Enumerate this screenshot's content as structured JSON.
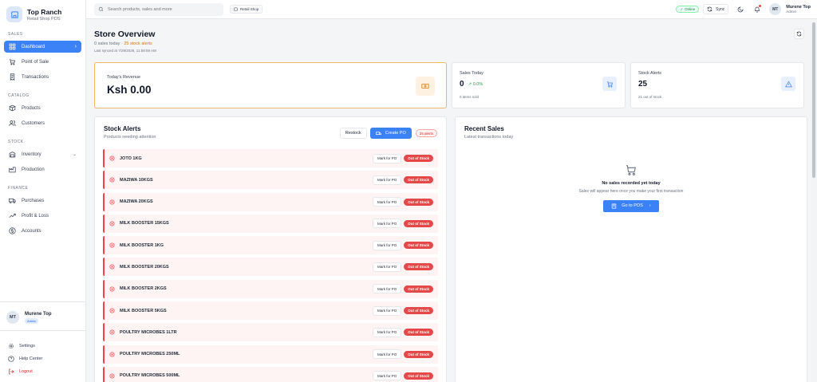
{
  "brand": {
    "name": "Top Ranch",
    "subtitle": "Retail Shop POS"
  },
  "sidebar": {
    "sections": [
      {
        "label": "SALES"
      },
      {
        "label": "CATALOG"
      },
      {
        "label": "STOCK"
      },
      {
        "label": "FINANCE"
      }
    ],
    "items": [
      {
        "label": "Dashboard",
        "icon": "dashboard-icon"
      },
      {
        "label": "Point of Sale",
        "icon": "cart-icon"
      },
      {
        "label": "Transactions",
        "icon": "receipt-icon"
      },
      {
        "label": "Products",
        "icon": "box-icon"
      },
      {
        "label": "Customers",
        "icon": "users-icon"
      },
      {
        "label": "Inventory",
        "icon": "warehouse-icon"
      },
      {
        "label": "Production",
        "icon": "factory-icon"
      },
      {
        "label": "Purchases",
        "icon": "truck-icon"
      },
      {
        "label": "Profit & Loss",
        "icon": "trend-icon"
      },
      {
        "label": "Accounts",
        "icon": "dollar-icon"
      }
    ],
    "user": {
      "initials": "MT",
      "name": "Murene Top",
      "role": "Admin"
    },
    "footer": {
      "settings": "Settings",
      "help": "Help Center",
      "logout": "Logout"
    }
  },
  "topbar": {
    "search_placeholder": "Search products, sales and more",
    "shop": "Retail Shop",
    "online": "Online",
    "sync": "Sync",
    "user": {
      "initials": "MT",
      "name": "Murene Top",
      "role": "Admin"
    }
  },
  "page": {
    "title": "Store Overview",
    "sub_sales": "0 sales today",
    "sub_sep": " · ",
    "sub_alerts": "25 stock alerts",
    "synced": "Last synced at 7/29/2026, 11:59:59 AM"
  },
  "revenue": {
    "label": "Today's Revenue",
    "value": "Ksh 0.00"
  },
  "sales_today": {
    "label": "Sales Today",
    "value": "0",
    "change": "0.0%",
    "foot": "0 items sold"
  },
  "stock_alerts_stat": {
    "label": "Stock Alerts",
    "value": "25",
    "foot": "21 out of stock"
  },
  "stock_alerts": {
    "title": "Stock Alerts",
    "subtitle": "Products needing attention",
    "restock": "Restock",
    "create_po": "Create PO",
    "count": "25 alerts",
    "mark_label": "Mark for PO",
    "status_label": "Out of Stock",
    "items": [
      "JOTO 1KG",
      "MAZIWA 10KGS",
      "MAZIWA 20KGS",
      "MILK BOOSTER 15KGS",
      "MILK BOOSTER 1KG",
      "MILK BOOSTER 20KGS",
      "MILK BOOSTER 2KGS",
      "MILK BOOSTER 5KGS",
      "POULTRY MICROBES 1LTR",
      "POULTRY MICROBES 250ML",
      "POULTRY MICROBES 500ML"
    ]
  },
  "recent_sales": {
    "title": "Recent Sales",
    "subtitle": "Latest transactions today",
    "empty_title": "No sales recorded yet today",
    "empty_sub": "Sales will appear here once you make your first transaction",
    "cta": "Go to POS"
  }
}
